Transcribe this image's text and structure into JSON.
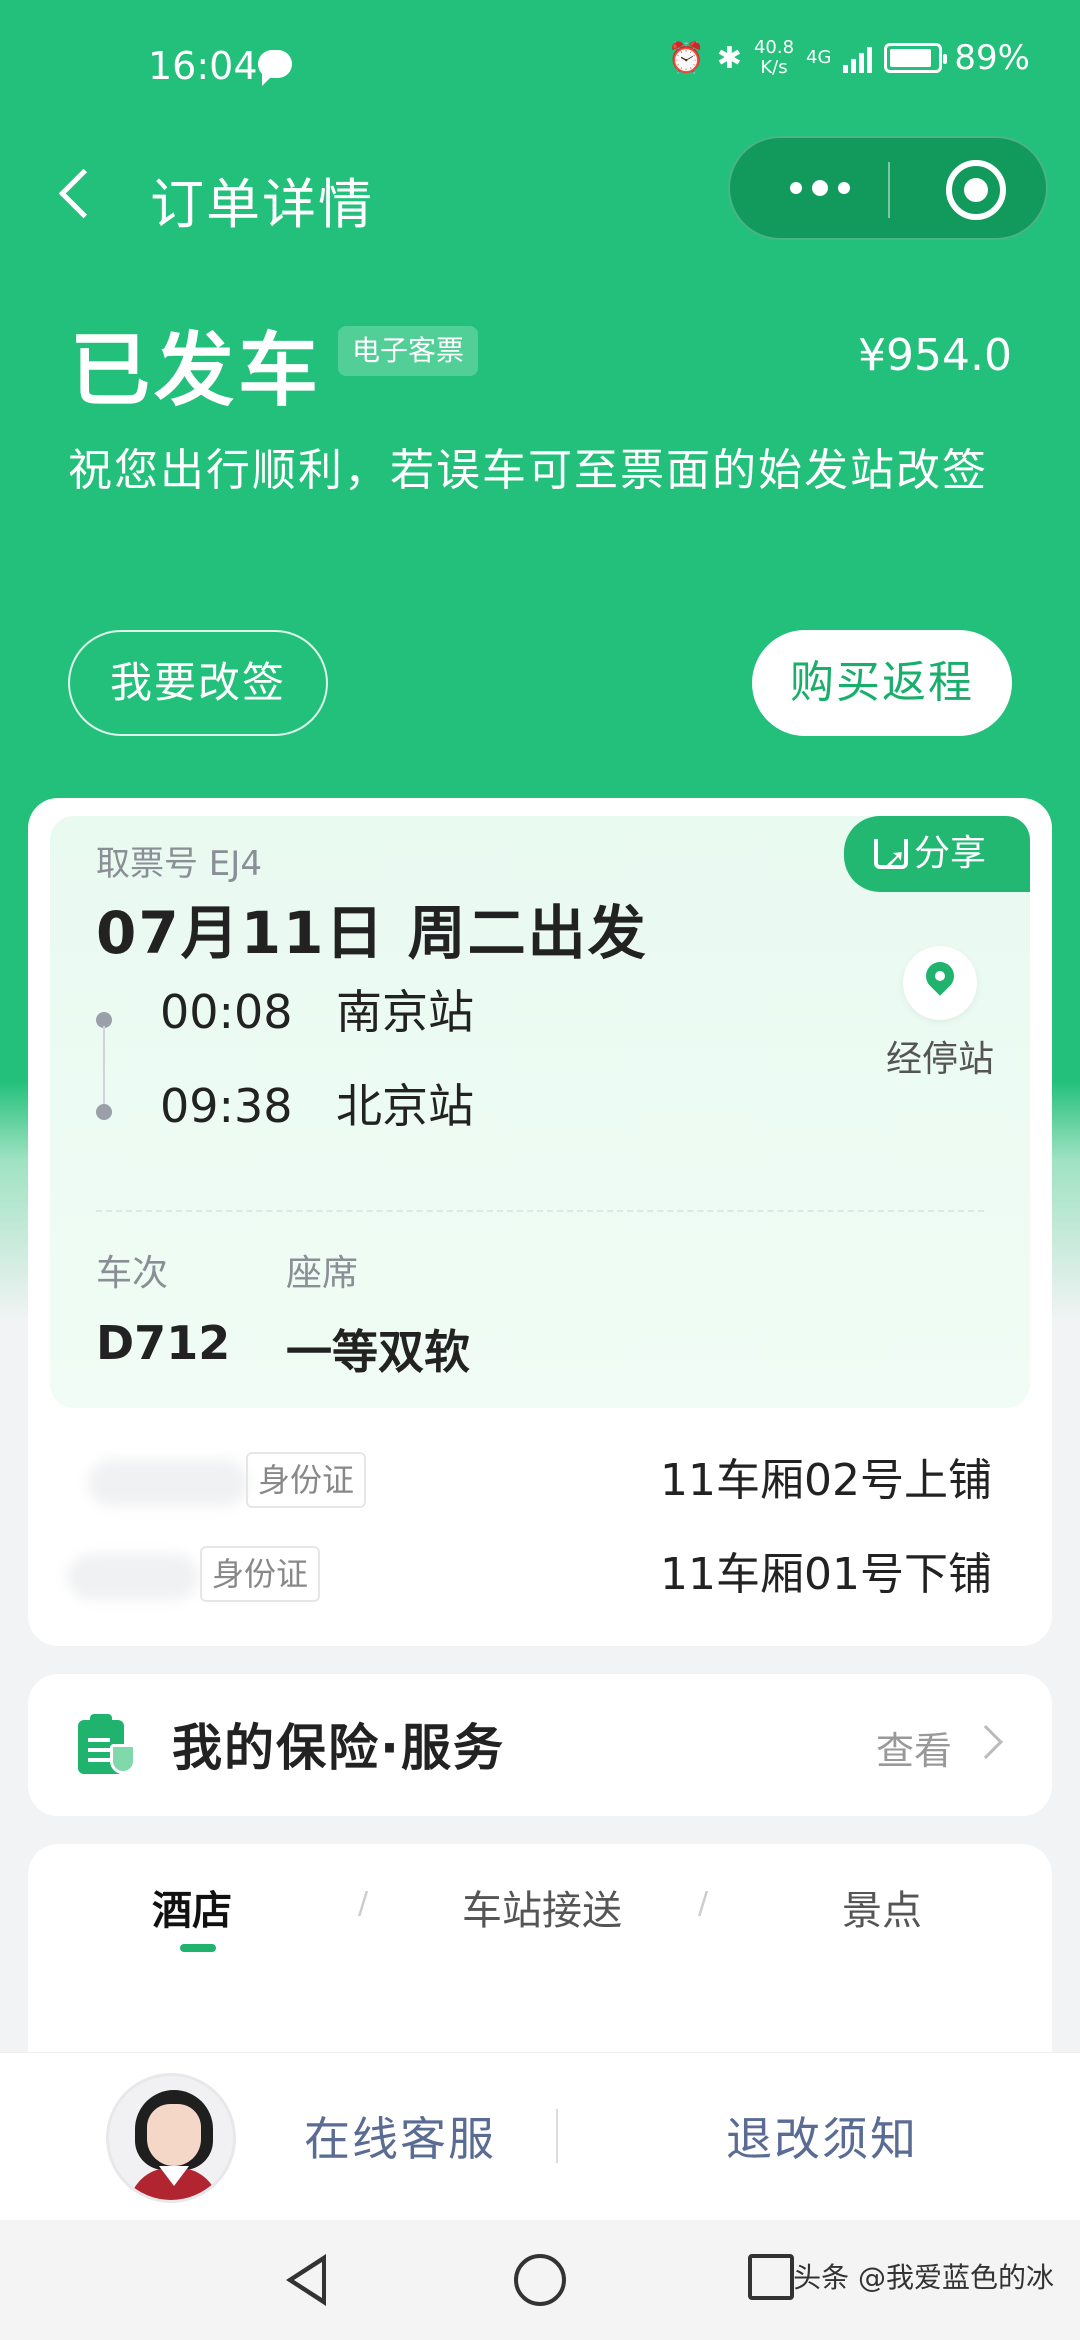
{
  "status_bar": {
    "time": "16:04",
    "net_speed_top": "40.8",
    "net_speed_bottom": "K/s",
    "network": "4G",
    "battery": "89%",
    "battery_level": 0.89
  },
  "nav": {
    "title": "订单详情"
  },
  "order": {
    "status": "已发车",
    "ticket_type": "电子客票",
    "price": "¥954.0",
    "notice": "祝您出行顺利，若误车可至票面的始发站改签",
    "change_label": "我要改签",
    "return_label": "购买返程"
  },
  "ticket": {
    "pickup": "取票号 EJ4",
    "share_label": "分享",
    "date": "07月11日 周二出发",
    "depart_time": "00:08",
    "depart_station": "南京站",
    "arrive_time": "09:38",
    "arrive_station": "北京站",
    "stops_label": "经停站",
    "train_label": "车次",
    "train_no": "D712",
    "seat_label": "座席",
    "seat_class": "一等双软"
  },
  "passengers": [
    {
      "id_type": "身份证",
      "seat": "11车厢02号上铺"
    },
    {
      "id_type": "身份证",
      "seat": "11车厢01号下铺"
    }
  ],
  "insurance": {
    "title": "我的保险·服务",
    "action": "查看"
  },
  "tabs": [
    {
      "label": "酒店",
      "active": true
    },
    {
      "label": "车站接送",
      "active": false
    },
    {
      "label": "景点",
      "active": false
    }
  ],
  "bottom": {
    "online_service": "在线客服",
    "rules": "退改须知"
  },
  "watermark": "头条 @我爱蓝色的冰",
  "colors": {
    "brand_green": "#22c07a",
    "link_blue": "#5a6c93"
  }
}
